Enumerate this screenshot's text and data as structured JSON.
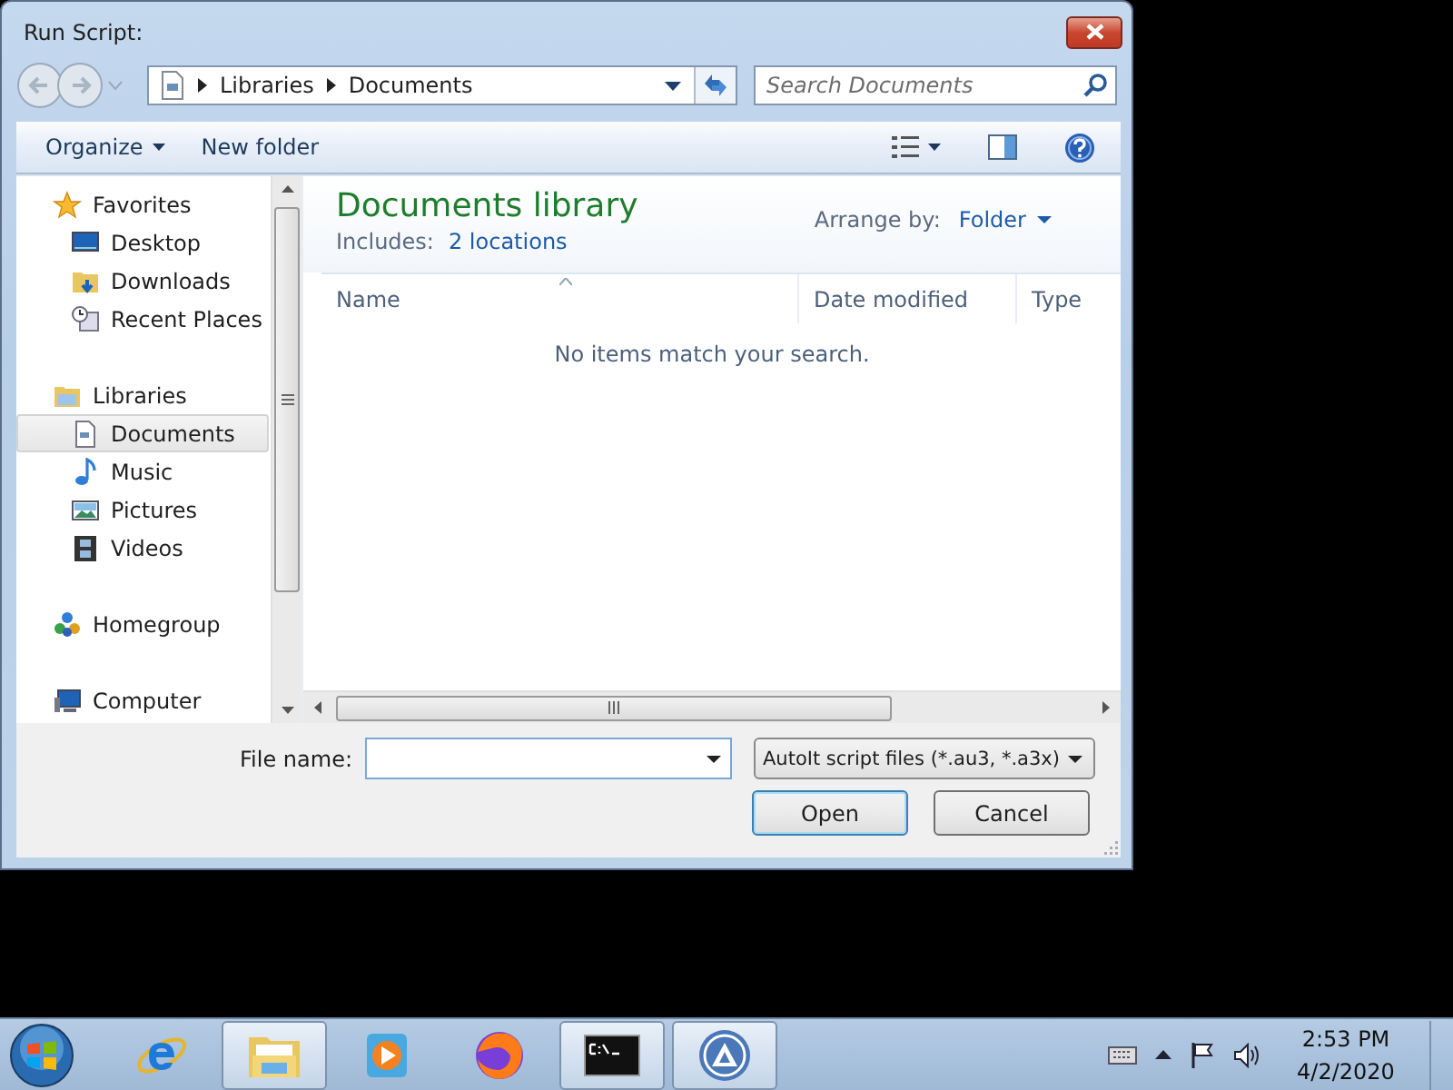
{
  "window": {
    "title": "Run Script:"
  },
  "address": {
    "crumbs": [
      "Libraries",
      "Documents"
    ]
  },
  "search": {
    "placeholder": "Search Documents"
  },
  "toolbar": {
    "items": [
      {
        "label": "Organize",
        "kind": "menu"
      },
      {
        "label": "New folder",
        "kind": "button"
      }
    ]
  },
  "sidebar": {
    "groups": [
      {
        "label": "Favorites",
        "selected": false,
        "children": [
          {
            "label": "Desktop",
            "selected": false
          },
          {
            "label": "Downloads",
            "selected": false
          },
          {
            "label": "Recent Places",
            "selected": false
          }
        ]
      },
      {
        "label": "Libraries",
        "selected": false,
        "children": [
          {
            "label": "Documents",
            "selected": true
          },
          {
            "label": "Music",
            "selected": false
          },
          {
            "label": "Pictures",
            "selected": false
          },
          {
            "label": "Videos",
            "selected": false
          }
        ]
      },
      {
        "label": "Homegroup",
        "selected": false
      },
      {
        "label": "Computer",
        "selected": false
      }
    ]
  },
  "content": {
    "title": "Documents library",
    "includes_label": "Includes:",
    "includes_link": "2 locations",
    "arrange_label": "Arrange by:",
    "arrange_value": "Folder",
    "columns": [
      {
        "label": "Name",
        "sorted": true
      },
      {
        "label": "Date modified",
        "sorted": false
      },
      {
        "label": "Type",
        "sorted": false
      }
    ],
    "empty_message": "No items match your search."
  },
  "file_name": {
    "label": "File name:"
  },
  "filter": {
    "value": "AutoIt script files (*.au3, *.a3x)"
  },
  "buttons": [
    {
      "label": "Open",
      "default": true
    },
    {
      "label": "Cancel",
      "default": false
    }
  ],
  "taskbar": {
    "apps": [
      {
        "running": false
      },
      {
        "running": true
      },
      {
        "running": false
      },
      {
        "running": false
      },
      {
        "running": true
      },
      {
        "running": true
      }
    ],
    "time": "2:53 PM",
    "date": "4/2/2020"
  }
}
